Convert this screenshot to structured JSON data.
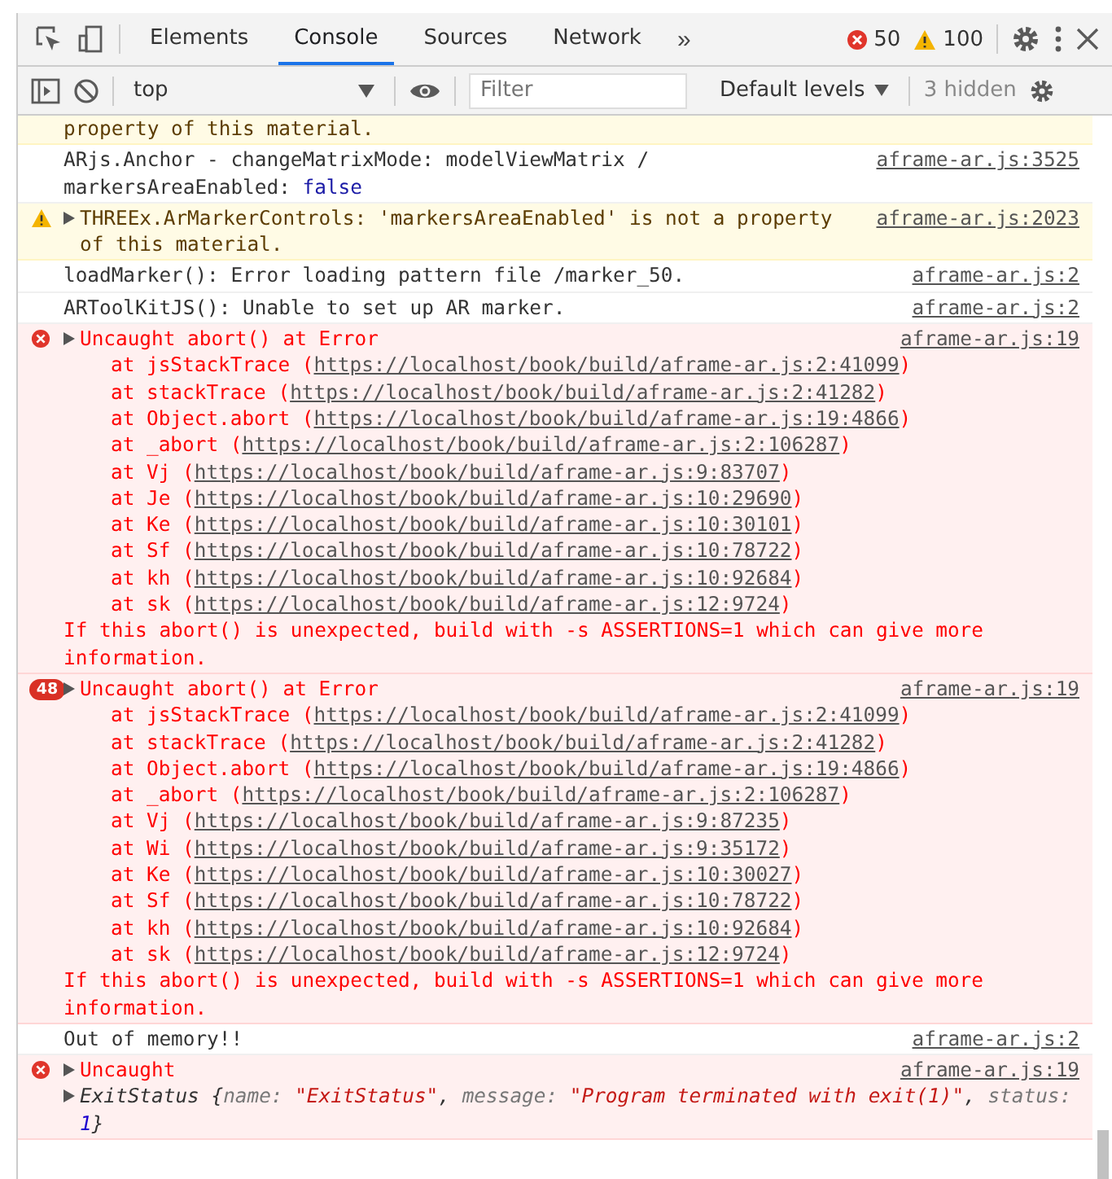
{
  "tabs": [
    {
      "label": "Elements",
      "selected": false
    },
    {
      "label": "Console",
      "selected": true
    },
    {
      "label": "Sources",
      "selected": false
    },
    {
      "label": "Network",
      "selected": false
    }
  ],
  "more_tabs": "»",
  "error_count": "50",
  "warning_count": "100",
  "console_toolbar": {
    "context": "top",
    "filter_placeholder": "Filter",
    "levels": "Default levels",
    "hidden": "3 hidden"
  },
  "messages": [
    {
      "kind": "warning",
      "clipped": true,
      "text": "property of this material."
    },
    {
      "kind": "log",
      "text": "ARjs.Anchor - changeMatrixMode: modelViewMatrix / markersAreaEnabled: ",
      "value": "false",
      "source": "aframe-ar.js:3525"
    },
    {
      "kind": "warning",
      "expandable": true,
      "text": "THREEx.ArMarkerControls: 'markersAreaEnabled' is not a property of this material.",
      "source": "aframe-ar.js:2023"
    },
    {
      "kind": "log",
      "text": "loadMarker(): Error loading pattern file /marker_50.",
      "source": "aframe-ar.js:2"
    },
    {
      "kind": "log",
      "text": "ARToolKitJS(): Unable to set up AR marker.",
      "source": "aframe-ar.js:2"
    },
    {
      "kind": "error",
      "expandable": true,
      "text": "Uncaught abort() at Error",
      "source": "aframe-ar.js:19",
      "stack": [
        {
          "prefix": "at jsStackTrace (",
          "url": "https://localhost/book/build/aframe-ar.js:2:41099",
          "suffix": ")"
        },
        {
          "prefix": "at stackTrace (",
          "url": "https://localhost/book/build/aframe-ar.js:2:41282",
          "suffix": ")"
        },
        {
          "prefix": "at Object.abort (",
          "url": "https://localhost/book/build/aframe-ar.js:19:4866",
          "suffix": ")"
        },
        {
          "prefix": "at _abort (",
          "url": "https://localhost/book/build/aframe-ar.js:2:106287",
          "suffix": ")"
        },
        {
          "prefix": "at Vj (",
          "url": "https://localhost/book/build/aframe-ar.js:9:83707",
          "suffix": ")"
        },
        {
          "prefix": "at Je (",
          "url": "https://localhost/book/build/aframe-ar.js:10:29690",
          "suffix": ")"
        },
        {
          "prefix": "at Ke (",
          "url": "https://localhost/book/build/aframe-ar.js:10:30101",
          "suffix": ")"
        },
        {
          "prefix": "at Sf (",
          "url": "https://localhost/book/build/aframe-ar.js:10:78722",
          "suffix": ")"
        },
        {
          "prefix": "at kh (",
          "url": "https://localhost/book/build/aframe-ar.js:10:92684",
          "suffix": ")"
        },
        {
          "prefix": "at sk (",
          "url": "https://localhost/book/build/aframe-ar.js:12:9724",
          "suffix": ")"
        }
      ],
      "footer": "If this abort() is unexpected, build with -s ASSERTIONS=1 which can give more information."
    },
    {
      "kind": "error",
      "repeat": "48",
      "expandable": true,
      "text": "Uncaught abort() at Error",
      "source": "aframe-ar.js:19",
      "stack": [
        {
          "prefix": "at jsStackTrace (",
          "url": "https://localhost/book/build/aframe-ar.js:2:41099",
          "suffix": ")"
        },
        {
          "prefix": "at stackTrace (",
          "url": "https://localhost/book/build/aframe-ar.js:2:41282",
          "suffix": ")"
        },
        {
          "prefix": "at Object.abort (",
          "url": "https://localhost/book/build/aframe-ar.js:19:4866",
          "suffix": ")"
        },
        {
          "prefix": "at _abort (",
          "url": "https://localhost/book/build/aframe-ar.js:2:106287",
          "suffix": ")"
        },
        {
          "prefix": "at Vj (",
          "url": "https://localhost/book/build/aframe-ar.js:9:87235",
          "suffix": ")"
        },
        {
          "prefix": "at Wi (",
          "url": "https://localhost/book/build/aframe-ar.js:9:35172",
          "suffix": ")"
        },
        {
          "prefix": "at Ke (",
          "url": "https://localhost/book/build/aframe-ar.js:10:30027",
          "suffix": ")"
        },
        {
          "prefix": "at Sf (",
          "url": "https://localhost/book/build/aframe-ar.js:10:78722",
          "suffix": ")"
        },
        {
          "prefix": "at kh (",
          "url": "https://localhost/book/build/aframe-ar.js:10:92684",
          "suffix": ")"
        },
        {
          "prefix": "at sk (",
          "url": "https://localhost/book/build/aframe-ar.js:12:9724",
          "suffix": ")"
        }
      ],
      "footer": "If this abort() is unexpected, build with -s ASSERTIONS=1 which can give more information."
    },
    {
      "kind": "log",
      "text": "Out of memory!!",
      "source": "aframe-ar.js:2"
    },
    {
      "kind": "error",
      "expandable": true,
      "text": "Uncaught",
      "source": "aframe-ar.js:19",
      "object": {
        "class_name": "ExitStatus",
        "open": "{",
        "close": "}",
        "props": [
          {
            "key": "name: ",
            "value": "\"ExitStatus\"",
            "kind": "string",
            "sep": ", "
          },
          {
            "key": "message: ",
            "value": "\"Program terminated with exit(1)\"",
            "kind": "string",
            "sep": ", "
          },
          {
            "key": "status: ",
            "value": "1",
            "kind": "number"
          }
        ]
      }
    }
  ]
}
